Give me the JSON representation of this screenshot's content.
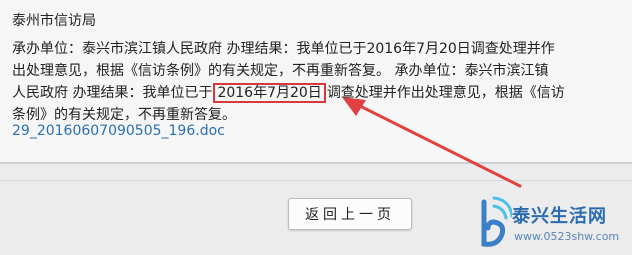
{
  "panel": {
    "agency": "泰州市信访局",
    "content_lines": [
      {
        "pre": "承办单位：泰兴市滨江镇人民政府 办理结果：我单位已于2016年7月20日调查处理并作",
        "hl": "",
        "post": ""
      },
      {
        "pre": "出处理意见，根据《信访条例》的有关规定，不再重新答复。 承办单位：泰兴市滨江镇",
        "hl": "",
        "post": ""
      },
      {
        "pre": "人民政府 办理结果：我单位已于",
        "hl": "2016年7月20日",
        "post": "调查处理并作出处理意见，根据《信访"
      },
      {
        "pre": "条例》的有关规定，不再重新答复。",
        "hl": "",
        "post": ""
      }
    ],
    "attachment": "29_20160607090505_196.doc"
  },
  "footer": {
    "back_label": "返回上一页"
  },
  "watermark": {
    "title": "泰兴生活网",
    "url": "www.0523shw.com"
  },
  "colors": {
    "highlight": "#d73a3a",
    "link": "#2a6fb0",
    "watermark": "#2b6cb0"
  }
}
